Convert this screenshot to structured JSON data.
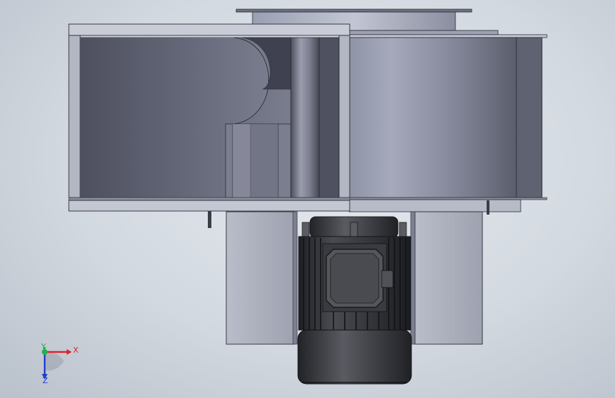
{
  "viewport": {
    "background_center": "#e4e9ef",
    "background_edge": "#b9c1cb"
  },
  "model": {
    "description_components": [
      "blower-housing",
      "impeller-inlet",
      "cooling-fins-housing",
      "electric-motor",
      "mounting-flange"
    ],
    "colors": {
      "housing_light": "#b4b8c8",
      "housing_dark": "#5d606e",
      "edge": "#2a2c35",
      "motor_body": "#2f3035",
      "motor_highlight": "#6b6d74"
    }
  },
  "triad": {
    "x_label": "X",
    "y_label": "Y",
    "z_label": "Z",
    "x_color": "#e0212b",
    "y_color": "#22b14c",
    "z_color": "#1f3fc9"
  }
}
